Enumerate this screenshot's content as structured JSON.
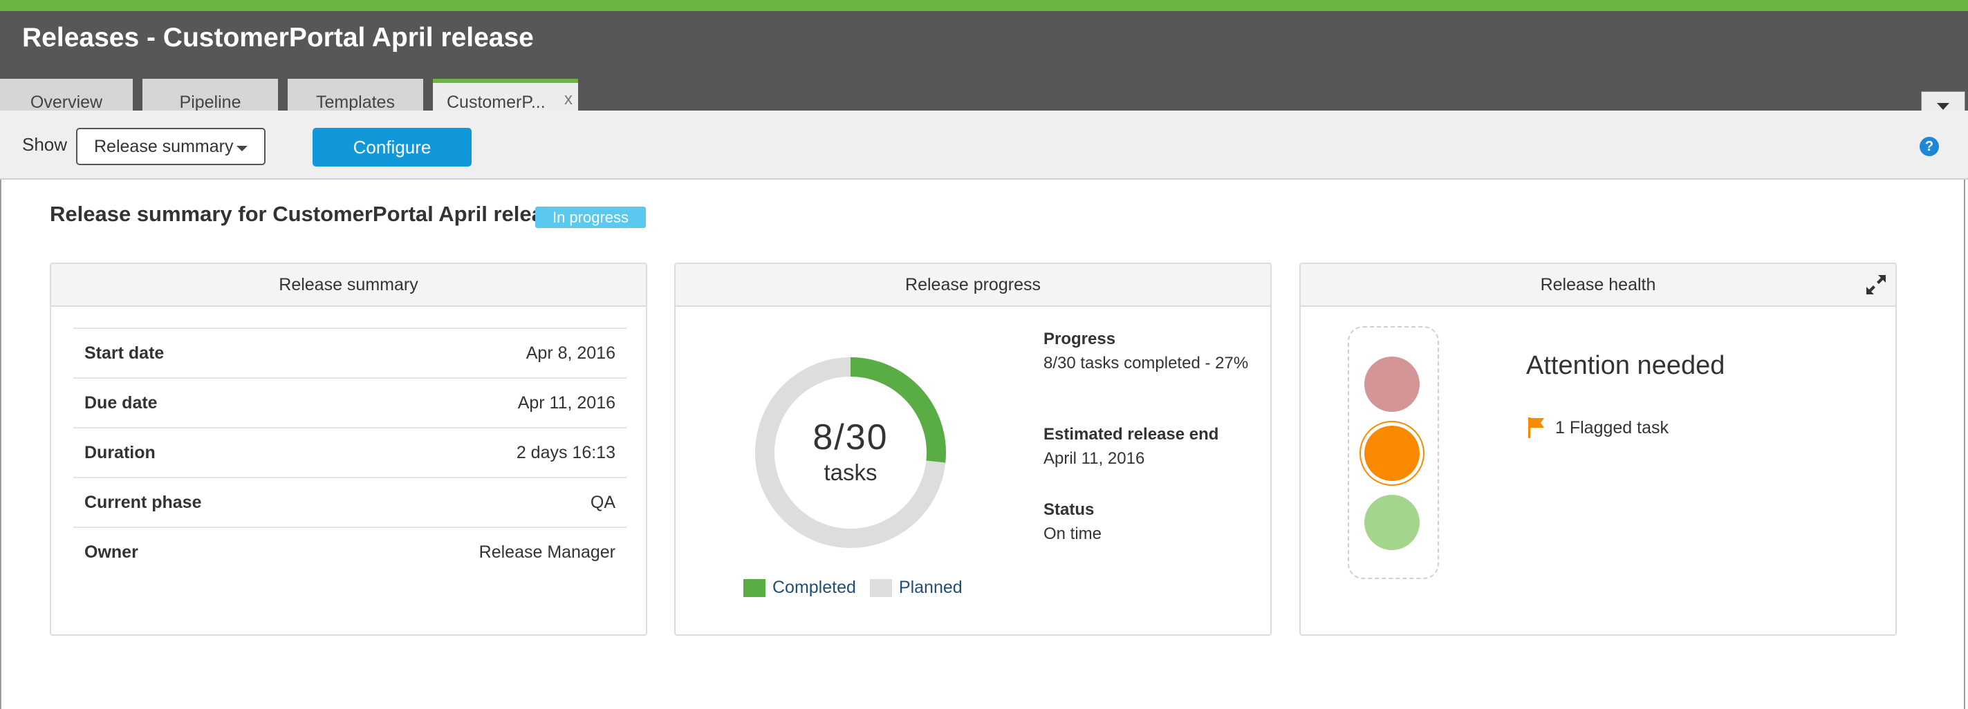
{
  "app": {
    "title": "Releases - CustomerPortal April release",
    "accent_color": "#6bb545",
    "header_bg": "#575757"
  },
  "tabs": [
    {
      "label": "Overview",
      "active": false
    },
    {
      "label": "Pipeline",
      "active": false
    },
    {
      "label": "Templates",
      "active": false
    },
    {
      "label": "CustomerP...",
      "active": true,
      "close": "x"
    }
  ],
  "toolbar": {
    "show_label": "Show",
    "view_select_value": "Release summary",
    "configure_label": "Configure",
    "help_icon": "?"
  },
  "summary": {
    "heading": "Release summary for CustomerPortal April release",
    "status_badge": "In progress",
    "badge_color": "#5bc8ef"
  },
  "release_summary": {
    "title": "Release summary",
    "rows": [
      {
        "key": "Start date",
        "value": "Apr 8, 2016"
      },
      {
        "key": "Due date",
        "value": "Apr 11, 2016"
      },
      {
        "key": "Duration",
        "value": "2 days 16:13"
      },
      {
        "key": "Current phase",
        "value": "QA"
      },
      {
        "key": "Owner",
        "value": "Release Manager"
      }
    ]
  },
  "release_progress": {
    "title": "Release progress",
    "completed": 8,
    "total": 30,
    "donut_number": "8/30",
    "donut_unit": "tasks",
    "completed_color": "#5aac44",
    "planned_color": "#dddddd",
    "legend": {
      "completed": "Completed",
      "planned": "Planned"
    },
    "progress_label": "Progress",
    "progress_value": "8/30 tasks completed - 27%",
    "est_end_label": "Estimated release end",
    "est_end_value": "April 11, 2016",
    "status_label": "Status",
    "status_value": "On time"
  },
  "release_health": {
    "title": "Release health",
    "headline": "Attention needed",
    "flagged_text": "1 Flagged task",
    "active_light": "amber",
    "colors": {
      "red": "#d49596",
      "amber": "#f98a00",
      "green": "#a3d58d"
    }
  }
}
